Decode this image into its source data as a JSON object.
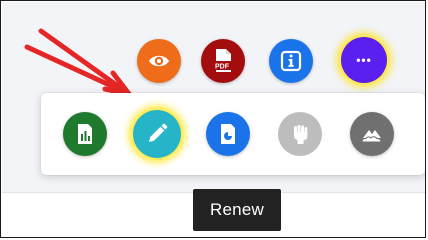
{
  "top_actions": [
    {
      "icon": "eye-icon",
      "color": "#ef6c1a"
    },
    {
      "icon": "pdf-file-icon",
      "icon_text": "PDF",
      "color": "#a30d0d"
    },
    {
      "icon": "info-icon",
      "color": "#1a73e8"
    },
    {
      "icon": "more-options-icon",
      "icon_text": "•••",
      "color": "#5b1ff0",
      "highlighted": true
    }
  ],
  "panel_actions": [
    {
      "icon": "spreadsheet-icon",
      "color": "#1f7a2e"
    },
    {
      "icon": "pencil-edit-icon",
      "color": "#25b4c8",
      "highlighted": true
    },
    {
      "icon": "document-chart-icon",
      "color": "#1a73e8"
    },
    {
      "icon": "raised-fist-icon",
      "color": "#bdbdbd"
    },
    {
      "icon": "cloud-landscape-icon",
      "color": "#707070"
    }
  ],
  "tooltip": {
    "label": "Renew"
  },
  "annotation": {
    "color": "#e52626"
  }
}
